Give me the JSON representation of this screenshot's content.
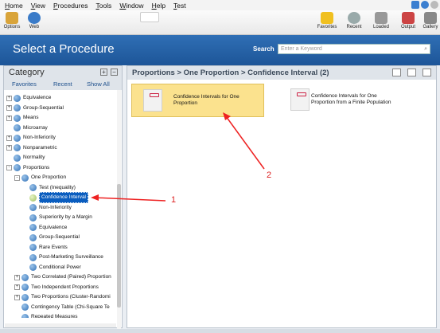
{
  "menu": [
    "Home",
    "View",
    "Procedures",
    "Tools",
    "Window",
    "Help",
    "Test"
  ],
  "toolbar": {
    "left": [
      {
        "label": "Options",
        "icon": "gears-icon"
      },
      {
        "label": "Web",
        "icon": "globe-icon"
      }
    ],
    "right": [
      {
        "label": "Favorites",
        "icon": "star-icon"
      },
      {
        "label": "Recent",
        "icon": "clock-icon"
      },
      {
        "label": "Loaded",
        "icon": "loaded-icon"
      },
      {
        "label": "Output",
        "icon": "chart-icon"
      },
      {
        "label": "Gallery",
        "icon": "gallery-icon"
      }
    ]
  },
  "header": {
    "title": "Select a Procedure",
    "search_label": "Search",
    "search_placeholder": "Enter a Keyword"
  },
  "category": {
    "title": "Category",
    "tabs": [
      "Favorites",
      "Recent",
      "Show All"
    ]
  },
  "tree": [
    {
      "label": "Equivalence",
      "level": 0,
      "exp": "+"
    },
    {
      "label": "Group-Sequential",
      "level": 0,
      "exp": "+"
    },
    {
      "label": "Means",
      "level": 0,
      "exp": "+"
    },
    {
      "label": "Microarray",
      "level": 0,
      "exp": ""
    },
    {
      "label": "Non-Inferiority",
      "level": 0,
      "exp": "+"
    },
    {
      "label": "Nonparametric",
      "level": 0,
      "exp": "+"
    },
    {
      "label": "Normality",
      "level": 0,
      "exp": ""
    },
    {
      "label": "Proportions",
      "level": 0,
      "exp": "-"
    },
    {
      "label": "One Proportion",
      "level": 1,
      "exp": "-"
    },
    {
      "label": "Test (Inequality)",
      "level": 2,
      "exp": ""
    },
    {
      "label": "Confidence Interval",
      "level": 2,
      "exp": "",
      "selected": true
    },
    {
      "label": "Non-Inferiority",
      "level": 2,
      "exp": ""
    },
    {
      "label": "Superiority by a Margin",
      "level": 2,
      "exp": ""
    },
    {
      "label": "Equivalence",
      "level": 2,
      "exp": ""
    },
    {
      "label": "Group-Sequential",
      "level": 2,
      "exp": ""
    },
    {
      "label": "Rare Events",
      "level": 2,
      "exp": ""
    },
    {
      "label": "Post-Marketing Surveillance",
      "level": 2,
      "exp": ""
    },
    {
      "label": "Conditional Power",
      "level": 2,
      "exp": ""
    },
    {
      "label": "Two Correlated (Paired) Proportion",
      "level": 1,
      "exp": "+"
    },
    {
      "label": "Two Independent Proportions",
      "level": 1,
      "exp": "+"
    },
    {
      "label": "Two Proportions (Cluster-Randomi",
      "level": 1,
      "exp": "+"
    },
    {
      "label": "Contingency Table (Chi-Square Te",
      "level": 1,
      "exp": ""
    },
    {
      "label": "Repeated Measures",
      "level": 1,
      "exp": ""
    }
  ],
  "breadcrumb": "Proportions > One Proportion > Confidence Interval (2)",
  "procedures": [
    {
      "label": "Confidence Intervals for One Proportion",
      "line1": "Confidence Intervals for One",
      "line2": "Proportion",
      "selected": true
    },
    {
      "label": "Confidence Intervals for One Proportion from a Finite Population",
      "line1": "Confidence Intervals for One",
      "line2": "Proportion from a Finite Population",
      "selected": false
    }
  ],
  "annotations": [
    "1",
    "2"
  ],
  "colors": {
    "header": "#1d5598",
    "selection": "#0a5dbf",
    "selected_card": "#fbe28e",
    "annotation": "#dd2222"
  }
}
